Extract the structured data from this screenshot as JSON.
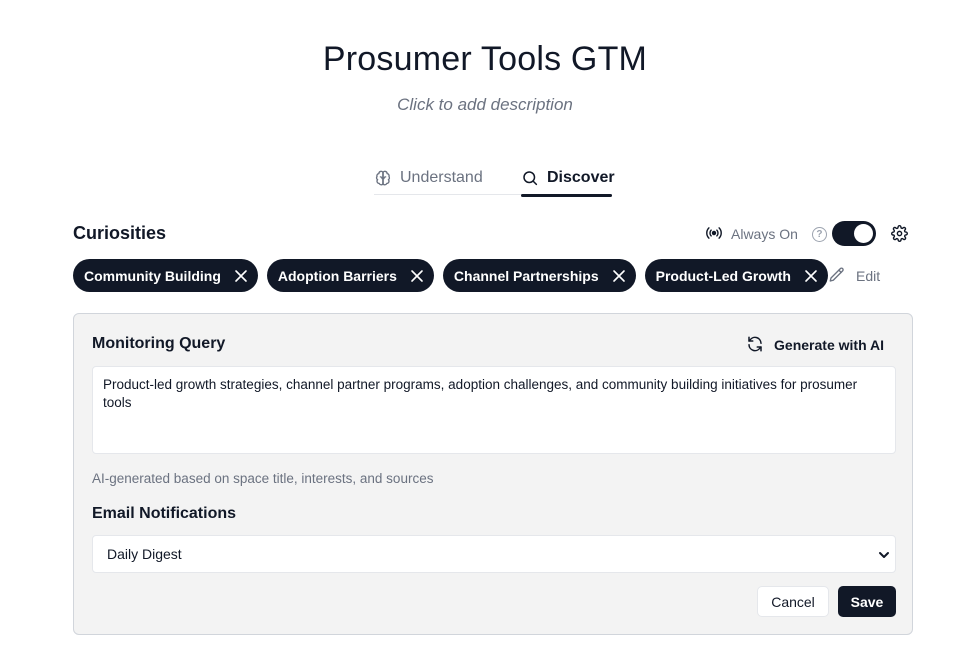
{
  "space": {
    "title": "Prosumer Tools GTM",
    "description_placeholder": "Click to add description"
  },
  "tabs": [
    {
      "label": "Understand",
      "icon": "brain-icon",
      "active": false
    },
    {
      "label": "Discover",
      "icon": "search-icon",
      "active": true
    }
  ],
  "curiosities": {
    "title": "Curiosities",
    "always_on_label": "Always On",
    "always_on_enabled": true,
    "chips": [
      {
        "label": "Community Building"
      },
      {
        "label": "Adoption Barriers"
      },
      {
        "label": "Channel Partnerships"
      },
      {
        "label": "Product-Led Growth"
      }
    ],
    "edit_label": "Edit"
  },
  "monitoring": {
    "title": "Monitoring Query",
    "generate_label": "Generate with AI",
    "query_text": "Product-led growth strategies, channel partner programs, adoption challenges, and community building initiatives for prosumer tools",
    "helper_text": "AI-generated based on space title, interests, and sources"
  },
  "notifications": {
    "title": "Email Notifications",
    "selected": "Daily Digest"
  },
  "actions": {
    "cancel_label": "Cancel",
    "save_label": "Save"
  },
  "colors": {
    "primary": "#111827",
    "muted": "#6b7280",
    "panel_bg": "#f3f3f3"
  }
}
